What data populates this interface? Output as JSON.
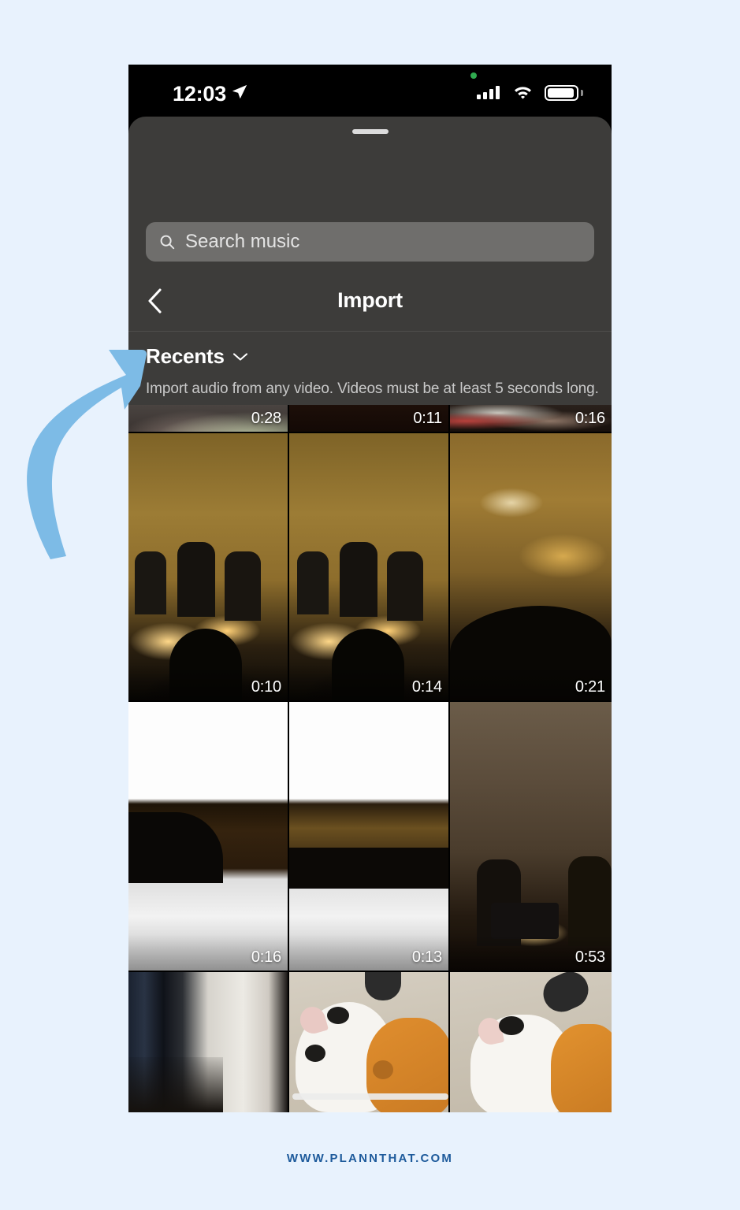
{
  "page": {
    "background_color": "#e8f2fd",
    "footer_url": "WWW.PLANNTHAT.COM",
    "footer_color": "#1d5a9b",
    "annotation_arrow_color": "#7dbbe6"
  },
  "status_bar": {
    "time": "12:03",
    "location_icon": "location-arrow-icon",
    "recording_dot_color": "#2fab4f",
    "cellular_icon": "cellular-bars-icon",
    "wifi_icon": "wifi-icon",
    "battery_icon": "battery-full-icon"
  },
  "sheet": {
    "grabber": "drag-handle",
    "background_color": "#3d3c3a"
  },
  "search": {
    "placeholder": "Search music",
    "icon": "search-icon",
    "value": ""
  },
  "navbar": {
    "back_icon": "chevron-left-icon",
    "title": "Import"
  },
  "recents": {
    "label": "Recents",
    "chevron_icon": "chevron-down-icon",
    "hint": "Import audio from any video. Videos must be at least 5 seconds long."
  },
  "grid": {
    "columns": 3,
    "rows": [
      {
        "partial": true,
        "cells": [
          {
            "duration": "0:28",
            "description": "person-in-green-top-partial"
          },
          {
            "duration": "0:11",
            "description": "very-dark-frame-partial"
          },
          {
            "duration": "0:16",
            "description": "people-red-shirt-partial"
          }
        ]
      },
      {
        "partial": false,
        "cells": [
          {
            "duration": "0:10",
            "description": "string-quartet-candlelit-brick-wall"
          },
          {
            "duration": "0:14",
            "description": "string-quartet-candlelit-brick-wall-alt"
          },
          {
            "duration": "0:21",
            "description": "blurred-concert-hall-chandelier"
          }
        ]
      },
      {
        "partial": false,
        "cells": [
          {
            "duration": "0:16",
            "description": "white-overexposed-then-audience-with-phone"
          },
          {
            "duration": "0:13",
            "description": "white-overexposed-then-concert-hall-audience"
          },
          {
            "duration": "0:53",
            "description": "violinists-stone-wall-candles"
          }
        ]
      },
      {
        "partial": true,
        "cells": [
          {
            "duration": "",
            "description": "dark-hallway-doorway"
          },
          {
            "duration": "",
            "description": "white-and-ginger-cats-on-carpet"
          },
          {
            "duration": "",
            "description": "white-and-ginger-cats-closeup"
          }
        ]
      }
    ]
  },
  "home_indicator": "home-indicator-bar"
}
